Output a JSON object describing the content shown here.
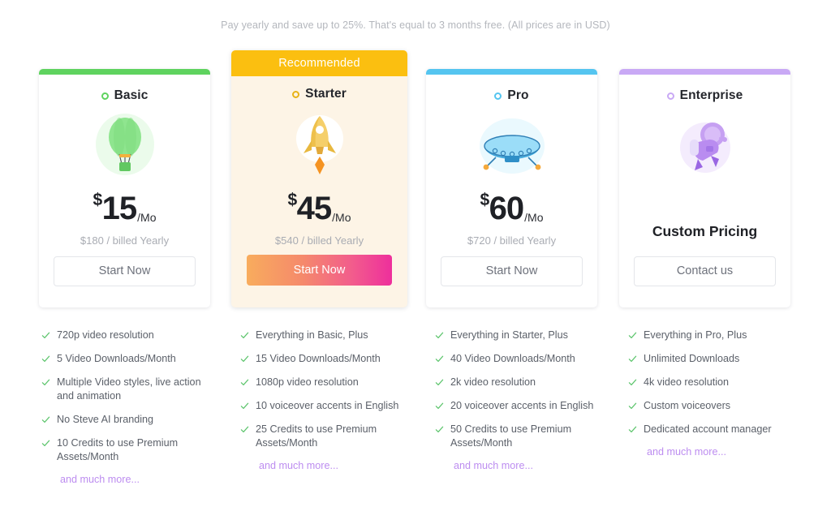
{
  "header": {
    "note": "Pay yearly and save up to 25%. That's equal to 3 months free. (All prices are in USD)"
  },
  "colors": {
    "basic": "#5fd35f",
    "starter": "#fbbf10",
    "pro": "#55c5f0",
    "enterprise": "#c9a9f5",
    "check": "#5bc46b",
    "more_link": "#bd8df0",
    "starter_card_bg": "#fdf4e6",
    "cta_gradient_from": "#f8ac5d",
    "cta_gradient_to": "#ee2f9c"
  },
  "plans": [
    {
      "name": "Basic",
      "ribbon": "",
      "icon": "balloon-illustration",
      "currency": "$",
      "amount": "15",
      "period": "/Mo",
      "billed": "$180 / billed Yearly",
      "cta": "Start Now",
      "features": [
        "720p video resolution",
        "5 Video Downloads/Month",
        "Multiple Video styles, live action and animation",
        "No Steve AI branding",
        "10 Credits to use Premium Assets/Month"
      ],
      "more": "and much more..."
    },
    {
      "name": "Starter",
      "ribbon": "Recommended",
      "icon": "rocket-illustration",
      "currency": "$",
      "amount": "45",
      "period": "/Mo",
      "billed": "$540 / billed Yearly",
      "cta": "Start Now",
      "features": [
        "Everything in Basic, Plus",
        "15 Video Downloads/Month",
        "1080p video resolution",
        "10 voiceover accents in English",
        "25 Credits to use Premium Assets/Month"
      ],
      "more": "and much more..."
    },
    {
      "name": "Pro",
      "ribbon": "",
      "icon": "ufo-illustration",
      "currency": "$",
      "amount": "60",
      "period": "/Mo",
      "billed": "$720 / billed Yearly",
      "cta": "Start Now",
      "features": [
        "Everything in Starter, Plus",
        "40 Video Downloads/Month",
        "2k video resolution",
        "20 voiceover accents in English",
        "50 Credits to use Premium Assets/Month"
      ],
      "more": "and much more..."
    },
    {
      "name": "Enterprise",
      "ribbon": "",
      "icon": "astronaut-illustration",
      "currency": "",
      "amount": "",
      "period": "",
      "billed": "",
      "custom_price": "Custom Pricing",
      "cta": "Contact us",
      "features": [
        "Everything in Pro, Plus",
        "Unlimited Downloads",
        "4k video resolution",
        "Custom voiceovers",
        "Dedicated account manager"
      ],
      "more": "and much more..."
    }
  ]
}
